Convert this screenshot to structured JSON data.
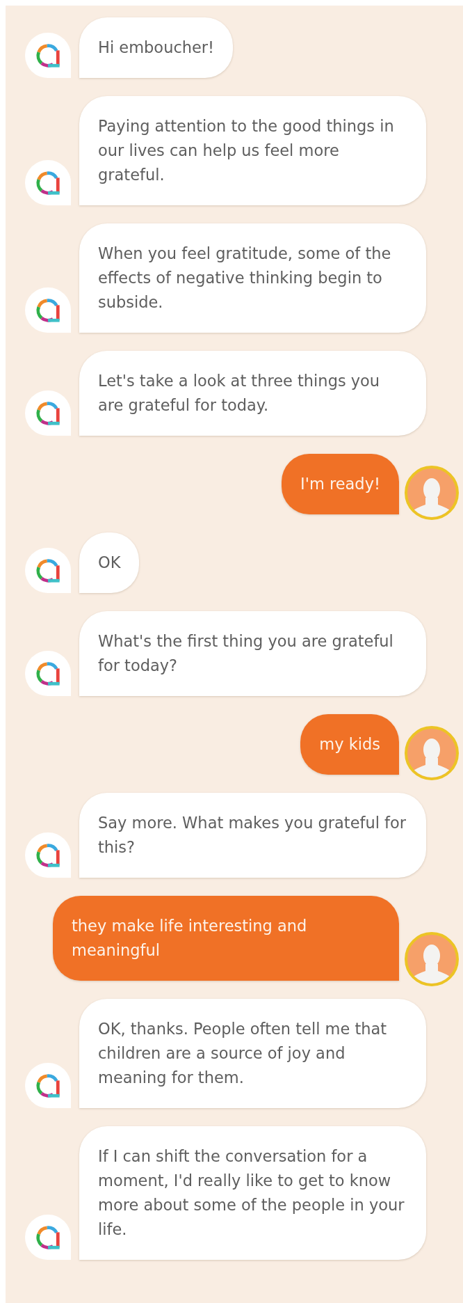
{
  "messages": [
    {
      "kind": "bot",
      "text": "Hi embouchеr!"
    },
    {
      "kind": "bot",
      "text": "Paying attention to the good things in our lives can help us feel more grateful."
    },
    {
      "kind": "bot",
      "text": "When you feel gratitude, some of the effects of negative thinking begin to subside."
    },
    {
      "kind": "bot",
      "text": "Let's take a look at three things you are grateful for today."
    },
    {
      "kind": "user",
      "text": "I'm ready!"
    },
    {
      "kind": "bot",
      "text": "OK"
    },
    {
      "kind": "bot",
      "text": "What's the first thing you are grateful for today?"
    },
    {
      "kind": "user",
      "text": "my kids"
    },
    {
      "kind": "bot",
      "text": "Say more. What makes you grateful for this?"
    },
    {
      "kind": "user",
      "text": "they make life interesting and meaningful"
    },
    {
      "kind": "bot",
      "text": "OK, thanks. People often tell me that children are a source of joy and meaning for them."
    },
    {
      "kind": "bot",
      "text": "If I can shift the conversation for a moment, I'd really like to get to know more about some of the people in your life."
    }
  ]
}
